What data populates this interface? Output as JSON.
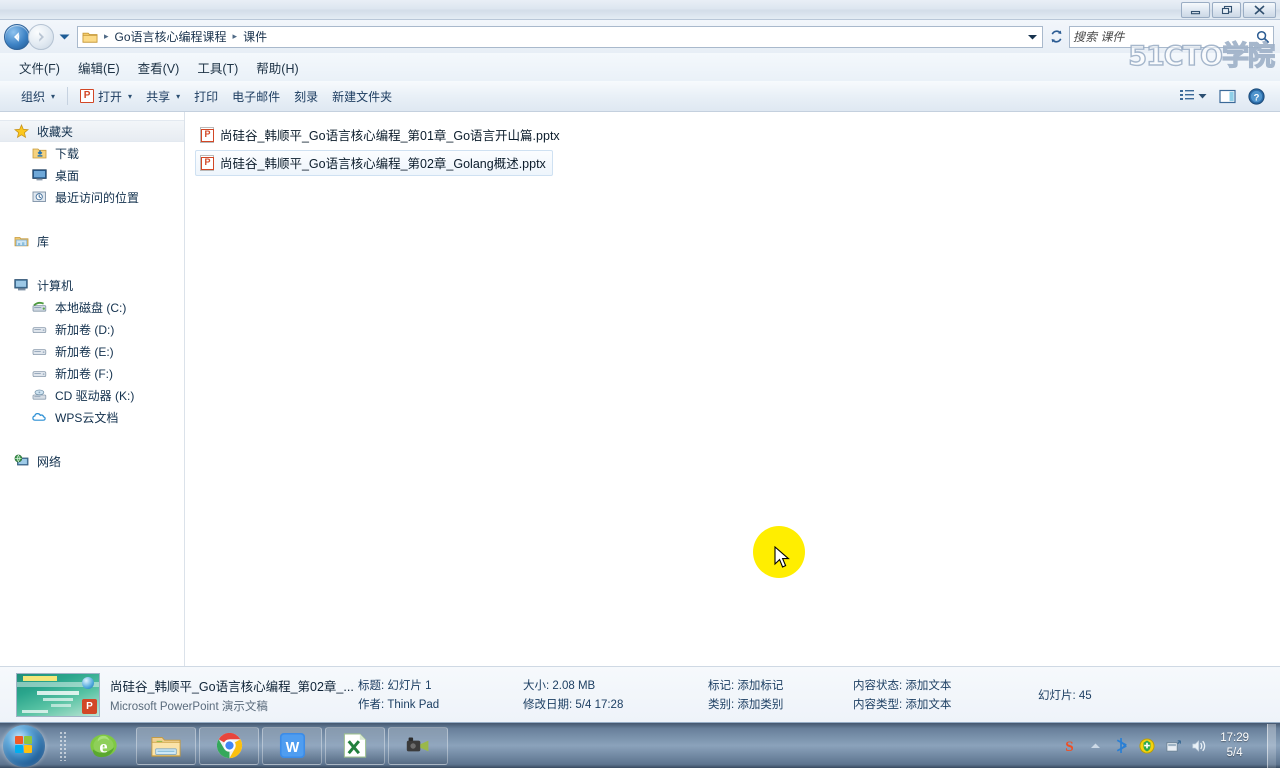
{
  "window": {
    "minimize_label": "最小化",
    "restore_label": "还原",
    "close_label": "关闭"
  },
  "watermark": "51CTO学院",
  "address": {
    "back_tooltip": "后退",
    "forward_tooltip": "前进",
    "recent_tooltip": "最近浏览的位置",
    "folder_icon": "folder-icon",
    "crumbs": [
      "Go语言核心编程课程",
      "课件"
    ],
    "separator": "▸",
    "dropdown_icon": "chevron-down-icon",
    "refresh_icon": "refresh-icon"
  },
  "search": {
    "placeholder": "搜索 课件",
    "value": "",
    "icon": "search-icon"
  },
  "menu": {
    "items": [
      {
        "label": "文件(F)",
        "name": "menu-file"
      },
      {
        "label": "编辑(E)",
        "name": "menu-edit"
      },
      {
        "label": "查看(V)",
        "name": "menu-view"
      },
      {
        "label": "工具(T)",
        "name": "menu-tools"
      },
      {
        "label": "帮助(H)",
        "name": "menu-help"
      }
    ]
  },
  "toolbar": {
    "organize": "组织",
    "open": "打开",
    "open_icon_letter": "P",
    "share": "共享",
    "print": "打印",
    "email": "电子邮件",
    "burn": "刻录",
    "new_folder": "新建文件夹",
    "caret": "▾",
    "view_icon": "view-options-icon",
    "preview_pane_icon": "preview-pane-icon",
    "help_icon": "help-icon"
  },
  "sidebar": {
    "groups": [
      {
        "name": "favorites",
        "header": {
          "label": "收藏夹",
          "icon": "star-icon",
          "selected": true
        },
        "items": [
          {
            "label": "下载",
            "icon": "downloads-folder-icon"
          },
          {
            "label": "桌面",
            "icon": "desktop-icon"
          },
          {
            "label": "最近访问的位置",
            "icon": "recent-places-icon"
          }
        ]
      },
      {
        "name": "libraries",
        "header": {
          "label": "库",
          "icon": "libraries-icon",
          "selected": false
        },
        "items": []
      },
      {
        "name": "computer",
        "header": {
          "label": "计算机",
          "icon": "computer-icon",
          "selected": false
        },
        "items": [
          {
            "label": "本地磁盘 (C:)",
            "icon": "system-drive-icon"
          },
          {
            "label": "新加卷 (D:)",
            "icon": "drive-icon"
          },
          {
            "label": "新加卷 (E:)",
            "icon": "drive-icon"
          },
          {
            "label": "新加卷 (F:)",
            "icon": "drive-icon"
          },
          {
            "label": "CD 驱动器 (K:)",
            "icon": "cd-drive-icon"
          },
          {
            "label": "WPS云文档",
            "icon": "cloud-icon"
          }
        ]
      },
      {
        "name": "network",
        "header": {
          "label": "网络",
          "icon": "network-icon",
          "selected": false
        },
        "items": []
      }
    ]
  },
  "files": [
    {
      "name": "尚硅谷_韩顺平_Go语言核心编程_第01章_Go语言开山篇.pptx",
      "icon": "pptx-file-icon",
      "selected": false
    },
    {
      "name": "尚硅谷_韩顺平_Go语言核心编程_第02章_Golang概述.pptx",
      "icon": "pptx-file-icon",
      "selected": true
    }
  ],
  "details": {
    "thumbnail_icon": "powerpoint-slide-thumbnail",
    "file_name": "尚硅谷_韩顺平_Go语言核心编程_第02章_...",
    "file_type": "Microsoft PowerPoint 演示文稿",
    "title_label": "标题: 幻灯片 1",
    "author_label": "作者: Think Pad",
    "size_label": "大小: 2.08 MB",
    "modified_label": "修改日期: 5/4 17:28",
    "tags_label": "标记: 添加标记",
    "category_label": "类别: 添加类别",
    "content_status_label": "内容状态: 添加文本",
    "content_type_label": "内容类型: 添加文本",
    "slides_label": "幻灯片: 45"
  },
  "taskbar": {
    "start_tooltip": "开始",
    "buttons": [
      {
        "name": "taskbar-ie",
        "label": "Internet Explorer",
        "icon": "internet-explorer-icon"
      },
      {
        "name": "taskbar-explorer",
        "label": "Windows 资源管理器",
        "icon": "folder-explorer-icon"
      },
      {
        "name": "taskbar-chrome",
        "label": "Google Chrome",
        "icon": "chrome-icon"
      },
      {
        "name": "taskbar-wps",
        "label": "WPS Writer",
        "icon": "wps-writer-icon"
      },
      {
        "name": "taskbar-excel",
        "label": "Microsoft Excel",
        "icon": "excel-icon"
      },
      {
        "name": "taskbar-recorder",
        "label": "屏幕录制",
        "icon": "camcorder-icon"
      }
    ],
    "tray": [
      {
        "name": "tray-sogou-ime",
        "icon": "sogou-ime-icon"
      },
      {
        "name": "tray-show-hidden",
        "icon": "chevron-up-icon"
      },
      {
        "name": "tray-bluetooth",
        "icon": "bluetooth-icon"
      },
      {
        "name": "tray-security",
        "icon": "shield-plus-icon"
      },
      {
        "name": "tray-safely-remove",
        "icon": "eject-device-icon"
      },
      {
        "name": "tray-volume",
        "icon": "speaker-icon"
      }
    ],
    "clock_time": "17:29",
    "clock_date": "5/4"
  },
  "colors": {
    "accent": "#2e6299",
    "ppt_orange": "#d24726",
    "highlight": "#ffee00",
    "taskbar": "#7b98b8"
  }
}
